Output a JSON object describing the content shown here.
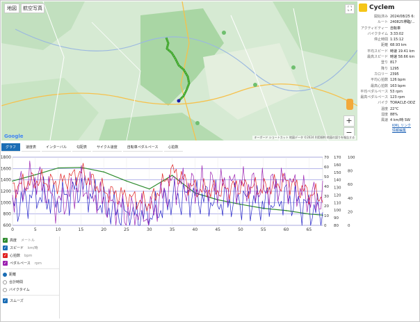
{
  "map": {
    "btn_map": "地図",
    "btn_satellite": "航空写真",
    "fullscreen": "⛶",
    "zoom_in": "+",
    "zoom_out": "−",
    "google": "Google",
    "attribution": "キーボード ショートカット  地図データ ©2024  利用規約  地図の誤りを報告する",
    "colors": {
      "route": "#3a9d2e",
      "route_point": "#5fcc3a",
      "end": "#1a1aa8"
    }
  },
  "info": {
    "title": "Cyclem",
    "rows": [
      {
        "label": "開始済み",
        "value": "2024/08/25 6:"
      },
      {
        "label": "ルート",
        "value": "240825堺臨/..."
      },
      {
        "label": "アクティビティー",
        "value": "自転車"
      },
      {
        "label": "バイクタイム",
        "value": "3:33:02"
      },
      {
        "label": "停止時間",
        "value": "1:15:12"
      },
      {
        "label": "距離",
        "value": "68.93 km"
      },
      {
        "label": "平均スピード",
        "value": "時速 19.41 km"
      },
      {
        "label": "最高スピード",
        "value": "時速 58.66 km"
      },
      {
        "label": "登り",
        "value": "817"
      },
      {
        "label": "降り",
        "value": "1295"
      },
      {
        "label": "カロリー",
        "value": "2395"
      },
      {
        "label": "平均心拍数",
        "value": "126 bpm"
      },
      {
        "label": "最高心拍数",
        "value": "163 bpm"
      },
      {
        "label": "平均ペダルペース",
        "value": "53 rpm"
      },
      {
        "label": "最高ペダルペース",
        "value": "123 rpm"
      },
      {
        "label": "バイク",
        "value": "TORACLE-ODZ"
      },
      {
        "label": "温度",
        "value": "22°C"
      },
      {
        "label": "湿度",
        "value": "88%"
      },
      {
        "label": "風速",
        "value": "4 km/時 SW"
      }
    ],
    "link1": "KML リンク",
    "link2": "情報編集"
  },
  "tabs": [
    "グラフ",
    "速度表",
    "インターバル",
    "勾配表",
    "サイクル速度",
    "自転車ペダルペース",
    "心拍数"
  ],
  "chart_data": {
    "type": "line",
    "x": [
      0,
      5,
      10,
      15,
      20,
      25,
      30,
      35,
      40,
      45,
      50,
      55,
      60,
      65,
      68
    ],
    "xlim": [
      0,
      68
    ],
    "xticks": [
      0,
      5,
      10,
      15,
      20,
      25,
      30,
      35,
      40,
      45,
      50,
      55,
      60,
      65
    ],
    "left_ticks": [
      600,
      800,
      1000,
      1200,
      1400,
      1600,
      1800
    ],
    "right_ticks_a": [
      0,
      10,
      20,
      30,
      40,
      50,
      60,
      70
    ],
    "right_ticks_b": [
      80,
      90,
      100,
      110,
      120,
      130,
      140,
      150,
      160,
      170
    ],
    "right_ticks_c": [
      0,
      20,
      40,
      60,
      80,
      100
    ],
    "series": [
      {
        "name": "高度",
        "unit": "メートル",
        "color": "#2e8b2e",
        "axis": "left",
        "ylim": [
          600,
          1800
        ],
        "values": [
          1380,
          1490,
          1610,
          1620,
          1540,
          1380,
          1240,
          1480,
          1170,
          1050,
          970,
          900,
          860,
          800,
          780
        ]
      },
      {
        "name": "スピード",
        "unit": "km/時",
        "color": "#2424c8",
        "axis": "a",
        "ylim": [
          0,
          70
        ],
        "values": [
          18,
          32,
          24,
          40,
          20,
          10,
          8,
          28,
          30,
          24,
          26,
          22,
          28,
          18,
          12
        ]
      },
      {
        "name": "心拍数",
        "unit": "bpm",
        "color": "#e02020",
        "axis": "b",
        "ylim": [
          80,
          170
        ],
        "values": [
          130,
          140,
          135,
          150,
          125,
          118,
          108,
          152,
          128,
          126,
          132,
          128,
          138,
          122,
          118
        ]
      },
      {
        "name": "ペダルペース",
        "unit": "rpm",
        "color": "#9b1fb0",
        "axis": "c",
        "ylim": [
          0,
          100
        ],
        "values": [
          45,
          70,
          30,
          60,
          35,
          20,
          15,
          62,
          55,
          58,
          60,
          52,
          64,
          40,
          35
        ]
      }
    ]
  },
  "legend": {
    "items": [
      {
        "label": "高度",
        "unit": "メートル",
        "color": "#2e8b2e"
      },
      {
        "label": "スピード",
        "unit": "km/時",
        "color": "#1a6db5"
      },
      {
        "label": "心拍数",
        "unit": "bpm",
        "color": "#e02020"
      },
      {
        "label": "ペダルペース",
        "unit": "rpm",
        "color": "#9b1fb0"
      }
    ],
    "modes": [
      {
        "label": "距離",
        "on": true
      },
      {
        "label": "合計時間",
        "on": false
      },
      {
        "label": "バイクタイム",
        "on": false
      }
    ],
    "smooth": "スムーズ"
  }
}
